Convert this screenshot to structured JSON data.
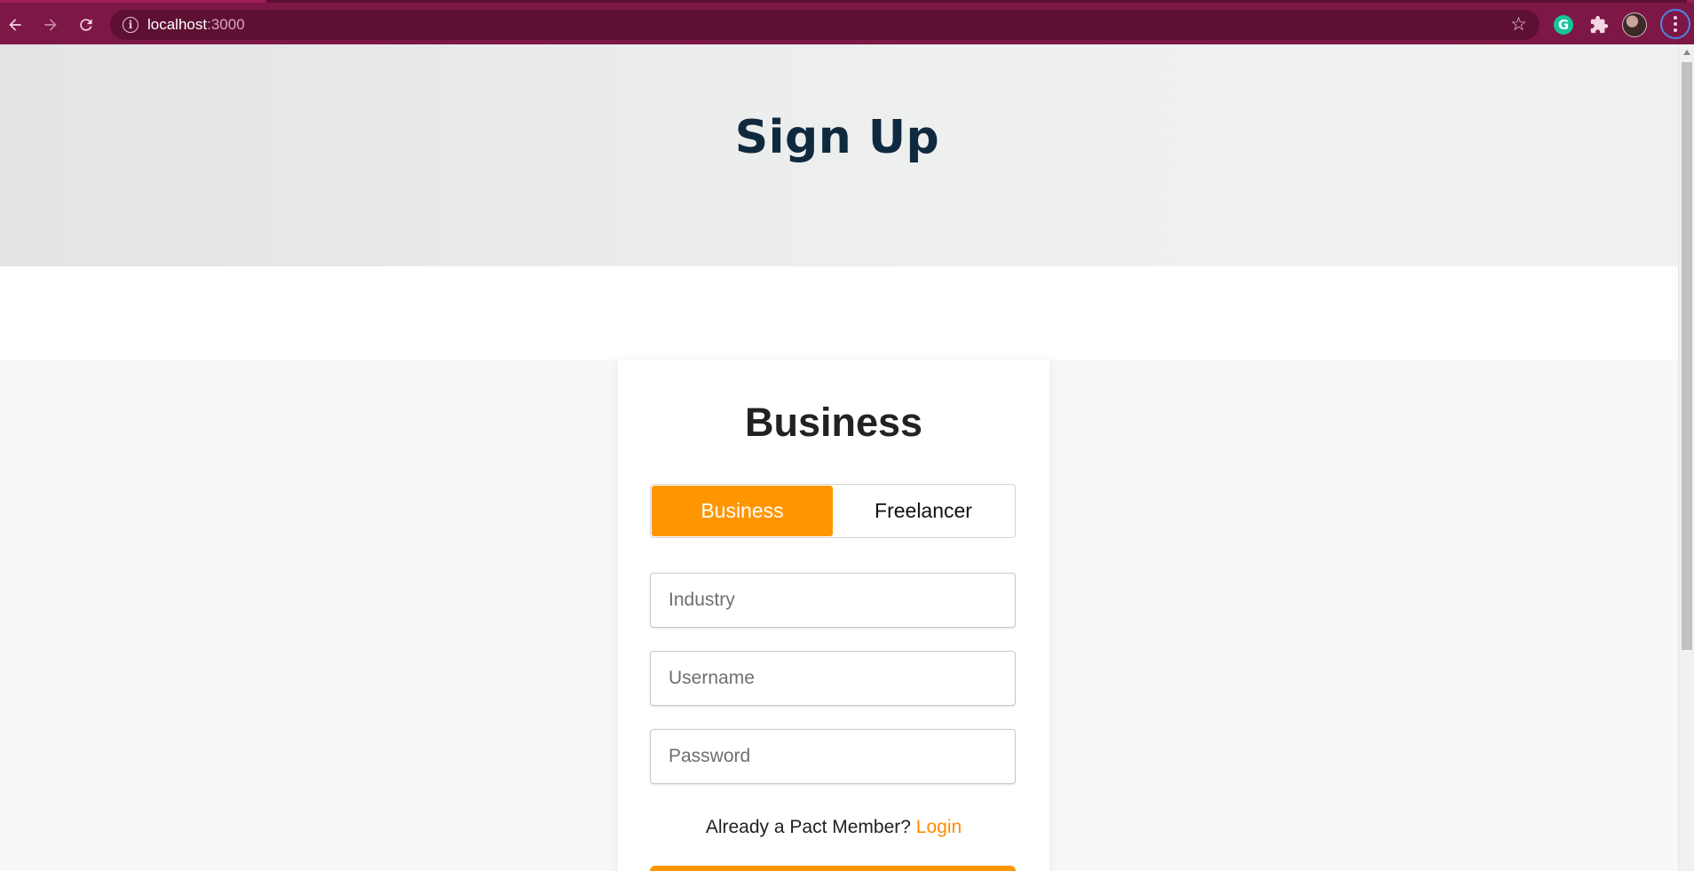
{
  "browser": {
    "url_host": "localhost",
    "url_port": ":3000"
  },
  "header": {
    "title": "Sign Up"
  },
  "form": {
    "heading": "Business",
    "toggle": {
      "options": [
        "Business",
        "Freelancer"
      ],
      "selected": "Business"
    },
    "fields": {
      "industry_placeholder": "Industry",
      "username_placeholder": "Username",
      "password_placeholder": "Password"
    },
    "login_prompt": "Already a Pact Member?",
    "login_link": "Login"
  },
  "colors": {
    "accent": "#ff9600",
    "heading": "#0f2a3f",
    "browser_frame": "#7d1746"
  }
}
